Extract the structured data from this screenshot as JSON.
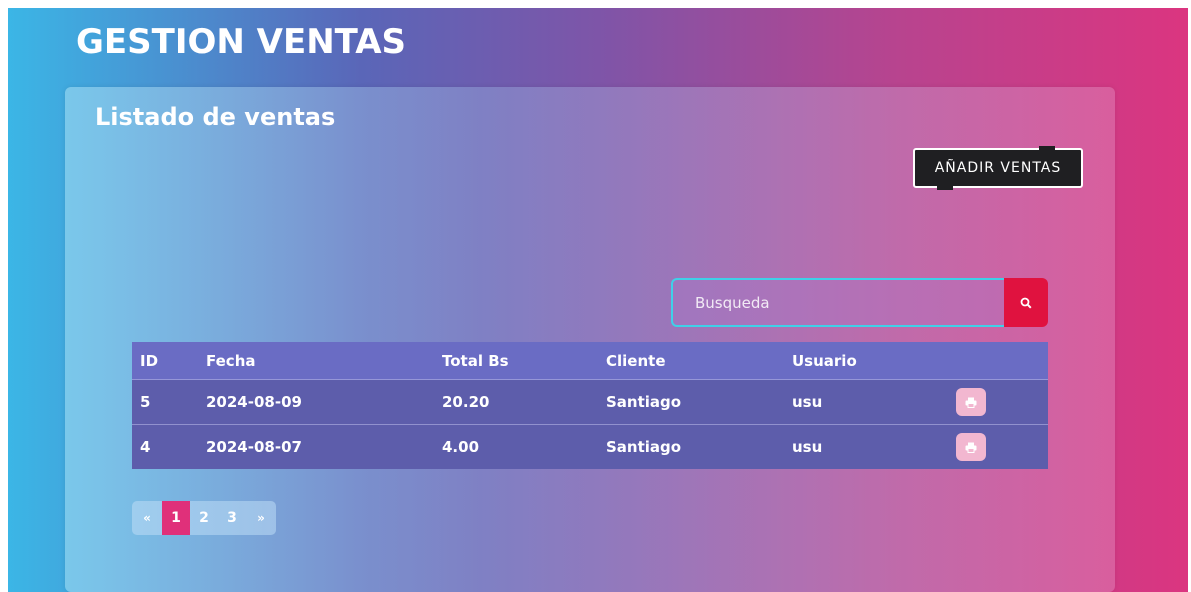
{
  "header": {
    "title": "GESTION VENTAS"
  },
  "card": {
    "title": "Listado de ventas",
    "add_button_label": "AÑADIR VENTAS"
  },
  "search": {
    "placeholder": "Busqueda",
    "value": "",
    "button_icon": "search-icon"
  },
  "table": {
    "columns": [
      "ID",
      "Fecha",
      "Total Bs",
      "Cliente",
      "Usuario",
      ""
    ],
    "rows": [
      {
        "id": "5",
        "fecha": "2024-08-09",
        "total": "20.20",
        "cliente": "Santiago",
        "usuario": "usu",
        "action_icon": "print-icon"
      },
      {
        "id": "4",
        "fecha": "2024-08-07",
        "total": "4.00",
        "cliente": "Santiago",
        "usuario": "usu",
        "action_icon": "print-icon"
      }
    ]
  },
  "pagination": {
    "prev_label": "«",
    "pages": [
      "1",
      "2",
      "3"
    ],
    "active_page": "1",
    "next_label": "»"
  },
  "colors": {
    "accent_red": "#e0123f",
    "accent_pink": "#e0307a",
    "table_header": "#6a6cc4",
    "table_row": "#5d5dab",
    "button_dark": "#1f1f22",
    "print_button": "#f2b7d0"
  }
}
